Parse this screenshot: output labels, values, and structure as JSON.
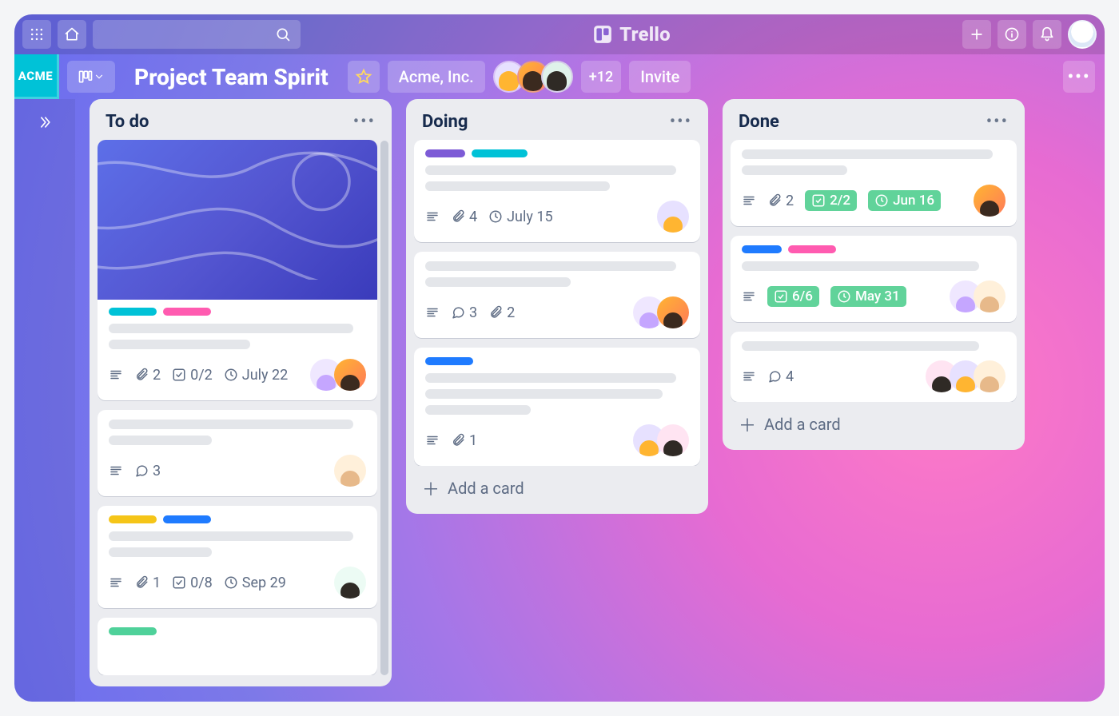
{
  "app": {
    "name": "Trello"
  },
  "workspace": {
    "badge": "ACME",
    "org_label": "Acme, Inc.",
    "extra_members": "+12",
    "invite_label": "Invite"
  },
  "board": {
    "title": "Project Team Spirit"
  },
  "lists": {
    "todo": {
      "title": "To do",
      "add_label": "Add a card",
      "cards": [
        {
          "has_cover": true,
          "labels": [
            "teal",
            "pink"
          ],
          "attachments": "2",
          "checklist": "0/2",
          "due": "July 22",
          "members": 2
        },
        {
          "labels": [],
          "comments": "3",
          "members": 1
        },
        {
          "labels": [
            "yellow",
            "blue"
          ],
          "attachments": "1",
          "checklist": "0/8",
          "due": "Sep 29",
          "members": 1
        },
        {
          "labels": [
            "green"
          ]
        }
      ]
    },
    "doing": {
      "title": "Doing",
      "add_label": "Add a card",
      "cards": [
        {
          "labels": [
            "purple",
            "teal"
          ],
          "attachments": "4",
          "due": "July 15",
          "members": 1
        },
        {
          "labels": [],
          "comments": "3",
          "attachments": "2",
          "members": 2
        },
        {
          "labels": [
            "blue"
          ],
          "attachments": "1",
          "members": 2
        }
      ]
    },
    "done": {
      "title": "Done",
      "add_label": "Add a card",
      "cards": [
        {
          "labels": [],
          "attachments": "2",
          "checklist": "2/2",
          "checklist_complete": true,
          "due": "Jun 16",
          "due_complete": true,
          "members": 1
        },
        {
          "labels": [
            "blue",
            "pink"
          ],
          "checklist": "6/6",
          "checklist_complete": true,
          "due": "May 31",
          "due_complete": true,
          "members": 2
        },
        {
          "labels": [],
          "comments": "4",
          "members": 3
        }
      ]
    }
  }
}
